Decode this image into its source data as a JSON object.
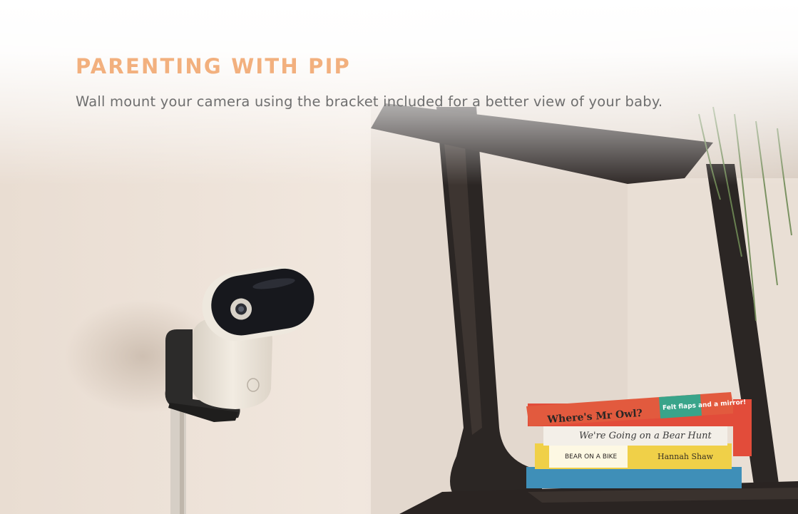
{
  "header": {
    "eyebrow": "PARENTING WITH PIP",
    "caption": "Wall mount your camera using the bracket included for a better view of your baby."
  },
  "photo": {
    "books": [
      "Where's Mr Owl?",
      "Felt flaps and a mirror!",
      "We're Going on a Bear Hunt",
      "BEAR ON A BIKE",
      "Hannah Shaw"
    ]
  },
  "colors": {
    "eyebrow": "#f2b07e",
    "caption": "#6f6f6f",
    "wall": "#ede3da",
    "shelf": "#2b2624"
  }
}
